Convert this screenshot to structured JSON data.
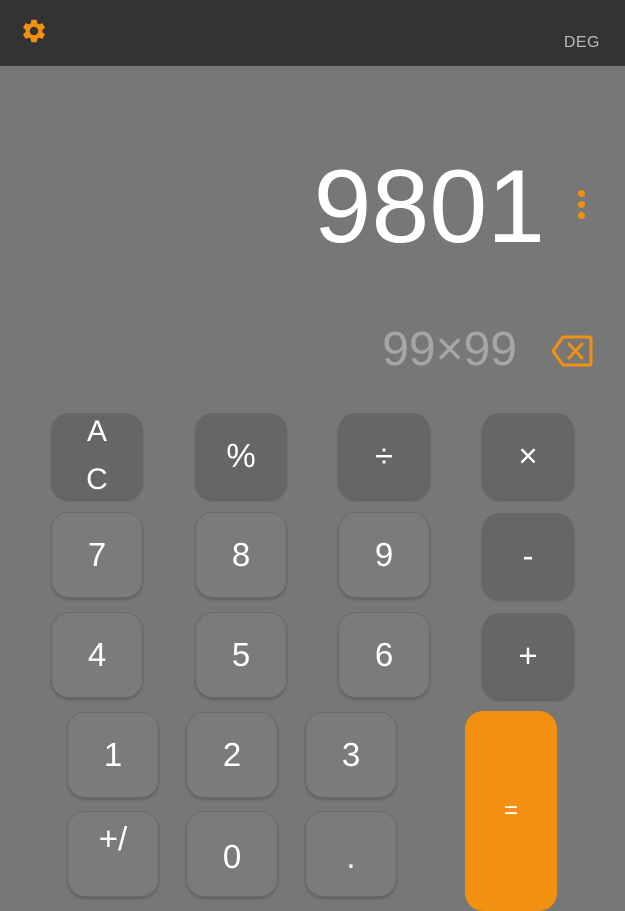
{
  "header": {
    "settings_icon": "gear-icon",
    "angle_mode": "DEG",
    "accent": "#f29111"
  },
  "display": {
    "result": "9801",
    "expression": "99×99",
    "more_icon": "more-vert-icon",
    "backspace_icon": "backspace-icon"
  },
  "keys": {
    "ac_line1": "A",
    "ac_line2": "C",
    "percent": "%",
    "divide": "÷",
    "multiply": "×",
    "k7": "7",
    "k8": "8",
    "k9": "9",
    "minus": "-",
    "k4": "4",
    "k5": "5",
    "k6": "6",
    "plus": "+",
    "k1": "1",
    "k2": "2",
    "k3": "3",
    "equals": "=",
    "plus_minus": "+/",
    "k0": "0",
    "decimal": "."
  }
}
